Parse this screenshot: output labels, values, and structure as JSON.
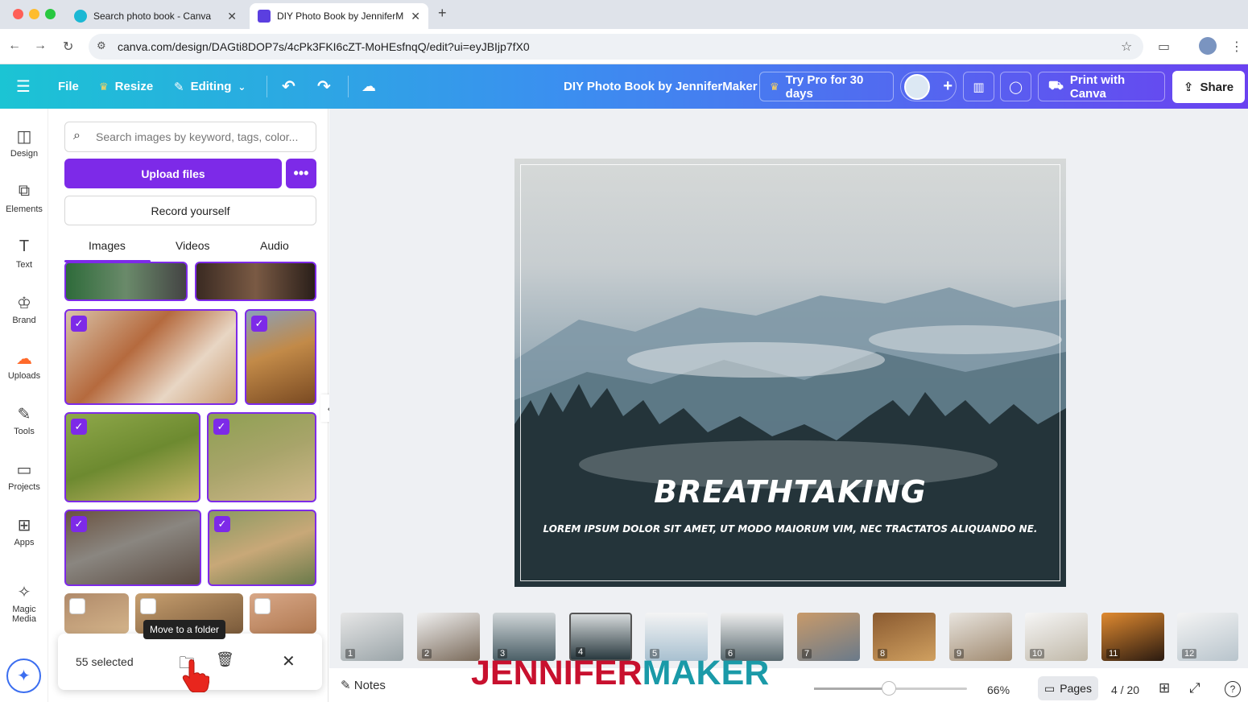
{
  "browser": {
    "tabs": [
      {
        "title": "Search photo book - Canva"
      },
      {
        "title": "DIY Photo Book by JenniferM"
      }
    ],
    "url": "canva.com/design/DAGti8DOP7s/4cPk3FKI6cZT-MoHEsfnqQ/edit?ui=eyJBIjp7fX0"
  },
  "topbar": {
    "file": "File",
    "resize": "Resize",
    "editing": "Editing",
    "doc_title": "DIY Photo Book by JenniferMaker",
    "try_pro": "Try Pro for 30 days",
    "print": "Print with Canva",
    "share": "Share"
  },
  "leftnav": [
    {
      "label": "Design",
      "icon": "design-icon"
    },
    {
      "label": "Elements",
      "icon": "elements-icon"
    },
    {
      "label": "Text",
      "icon": "text-icon"
    },
    {
      "label": "Brand",
      "icon": "brand-icon"
    },
    {
      "label": "Uploads",
      "icon": "uploads-icon"
    },
    {
      "label": "Tools",
      "icon": "tools-icon"
    },
    {
      "label": "Projects",
      "icon": "projects-icon"
    },
    {
      "label": "Apps",
      "icon": "apps-icon"
    },
    {
      "label": "Magic Media",
      "icon": "magic-media-icon"
    }
  ],
  "panel": {
    "search_placeholder": "Search images by keyword, tags, color...",
    "upload_label": "Upload files",
    "record_label": "Record yourself",
    "tabs": [
      "Images",
      "Videos",
      "Audio"
    ],
    "selected_count": "55 selected",
    "tooltip": "Move to a folder"
  },
  "canvas": {
    "headline": "BREATHTAKING",
    "subline": "LOREM IPSUM DOLOR SIT AMET, UT MODO MAIORUM VIM, NEC TRACTATOS ALIQUANDO NE."
  },
  "pages": [
    "1",
    "2",
    "3",
    "4",
    "5",
    "6",
    "7",
    "8",
    "9",
    "10",
    "11",
    "12"
  ],
  "bottom": {
    "notes": "Notes",
    "zoom": "66%",
    "pages_label": "Pages",
    "page_counter": "4 / 20"
  },
  "watermark": {
    "part1": "JENNIFER",
    "part2": "MAKER"
  },
  "colors": {
    "accent": "#7d2ae8",
    "logo_red": "#c8102e",
    "logo_teal": "#1a9aa8"
  }
}
